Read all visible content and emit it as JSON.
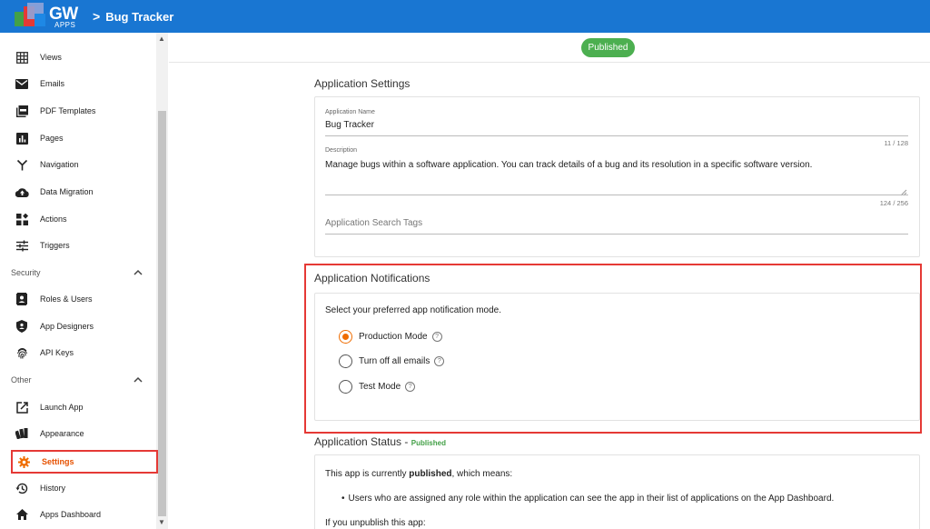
{
  "header": {
    "logo_text": "GW",
    "logo_sub": "APPS",
    "breadcrumb_chevron": ">",
    "app_title": "Bug Tracker"
  },
  "sidebar": {
    "items_top": [
      {
        "label": "Views",
        "icon": "grid-icon"
      },
      {
        "label": "Emails",
        "icon": "mail-icon"
      },
      {
        "label": "PDF Templates",
        "icon": "pdf-icon"
      },
      {
        "label": "Pages",
        "icon": "bar-chart-icon"
      },
      {
        "label": "Navigation",
        "icon": "fork-icon"
      },
      {
        "label": "Data Migration",
        "icon": "cloud-upload-icon"
      },
      {
        "label": "Actions",
        "icon": "widgets-icon"
      },
      {
        "label": "Triggers",
        "icon": "tune-icon"
      }
    ],
    "security_section": "Security",
    "items_security": [
      {
        "label": "Roles & Users",
        "icon": "contacts-icon"
      },
      {
        "label": "App Designers",
        "icon": "shield-icon"
      },
      {
        "label": "API Keys",
        "icon": "fingerprint-icon"
      }
    ],
    "other_section": "Other",
    "items_other": [
      {
        "label": "Launch App",
        "icon": "open-external-icon"
      },
      {
        "label": "Appearance",
        "icon": "palette-icon"
      },
      {
        "label": "Settings",
        "icon": "gear-icon",
        "active": true
      },
      {
        "label": "History",
        "icon": "history-icon"
      },
      {
        "label": "Apps Dashboard",
        "icon": "home-icon"
      }
    ]
  },
  "status_badge": "Published",
  "app_settings": {
    "heading": "Application Settings",
    "name_label": "Application Name",
    "name_value": "Bug Tracker",
    "name_counter": "11 / 128",
    "desc_label": "Description",
    "desc_value": "Manage bugs within a software application. You can track details of a bug and its resolution in a specific software version.",
    "desc_counter": "124 / 256",
    "tags_placeholder": "Application Search Tags"
  },
  "notifications": {
    "heading": "Application Notifications",
    "prompt": "Select your preferred app notification mode.",
    "options": [
      {
        "label": "Production Mode",
        "selected": true
      },
      {
        "label": "Turn off all emails",
        "selected": false
      },
      {
        "label": "Test Mode",
        "selected": false
      }
    ],
    "help_glyph": "?"
  },
  "app_status": {
    "heading": "Application Status -",
    "status": "Published",
    "line1_pre": "This app is currently ",
    "line1_bold": "published",
    "line1_post": ", which means:",
    "bullet1": "Users who are assigned any role within the application can see the app in their list of applications on the App Dashboard.",
    "line2": "If you unpublish this app:"
  },
  "colors": {
    "topbar": "#1976d2",
    "accent": "#ef6c00",
    "published": "#4caf50",
    "highlight": "#e53935"
  }
}
